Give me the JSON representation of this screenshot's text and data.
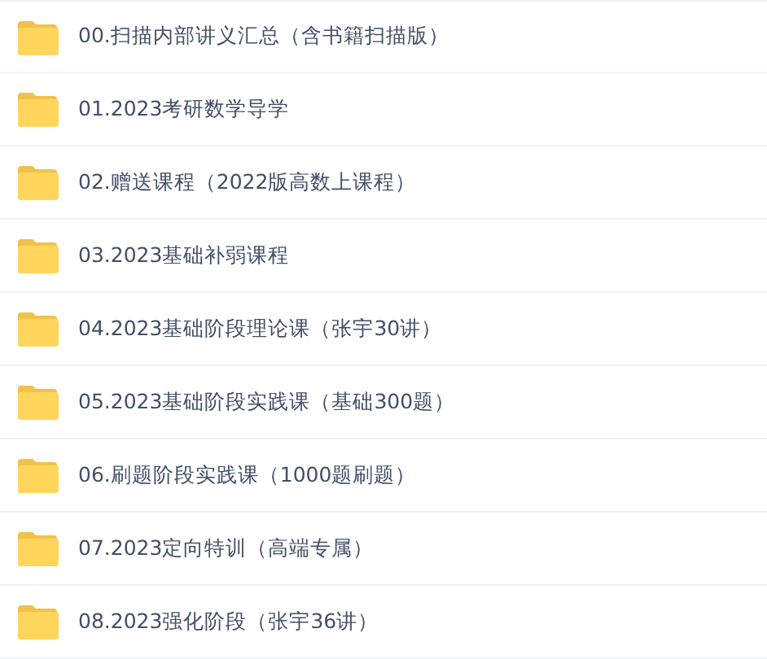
{
  "folders": [
    {
      "name": "00.扫描内部讲义汇总（含书籍扫描版）"
    },
    {
      "name": "01.2023考研数学导学"
    },
    {
      "name": "02.赠送课程（2022版高数上课程）"
    },
    {
      "name": "03.2023基础补弱课程"
    },
    {
      "name": "04.2023基础阶段理论课（张宇30讲）"
    },
    {
      "name": "05.2023基础阶段实践课（基础300题）"
    },
    {
      "name": "06.刷题阶段实践课（1000题刷题）"
    },
    {
      "name": "07.2023定向特训（高端专属）"
    },
    {
      "name": "08.2023强化阶段（张宇36讲）"
    }
  ]
}
